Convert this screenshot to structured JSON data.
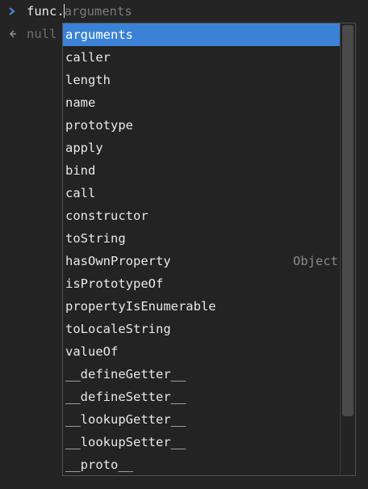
{
  "console": {
    "input": {
      "typed": "func.",
      "ghost_completion": "arguments"
    },
    "result": {
      "text": "null"
    },
    "colors": {
      "prompt_arrow": "#4a90e2",
      "result_arrow": "#8a8a8a",
      "selection": "#3b82d6"
    }
  },
  "autocomplete": {
    "items": [
      {
        "label": "arguments",
        "selected": true,
        "hint": ""
      },
      {
        "label": "caller",
        "hint": ""
      },
      {
        "label": "length",
        "hint": ""
      },
      {
        "label": "name",
        "hint": ""
      },
      {
        "label": "prototype",
        "hint": ""
      },
      {
        "label": "apply",
        "hint": ""
      },
      {
        "label": "bind",
        "hint": ""
      },
      {
        "label": "call",
        "hint": ""
      },
      {
        "label": "constructor",
        "hint": ""
      },
      {
        "label": "toString",
        "hint": ""
      },
      {
        "label": "hasOwnProperty",
        "hint": "Object"
      },
      {
        "label": "isPrototypeOf",
        "hint": ""
      },
      {
        "label": "propertyIsEnumerable",
        "hint": ""
      },
      {
        "label": "toLocaleString",
        "hint": ""
      },
      {
        "label": "valueOf",
        "hint": ""
      },
      {
        "label": "__defineGetter__",
        "hint": ""
      },
      {
        "label": "__defineSetter__",
        "hint": ""
      },
      {
        "label": "__lookupGetter__",
        "hint": ""
      },
      {
        "label": "__lookupSetter__",
        "hint": ""
      },
      {
        "label": "__proto__",
        "hint": ""
      }
    ]
  }
}
